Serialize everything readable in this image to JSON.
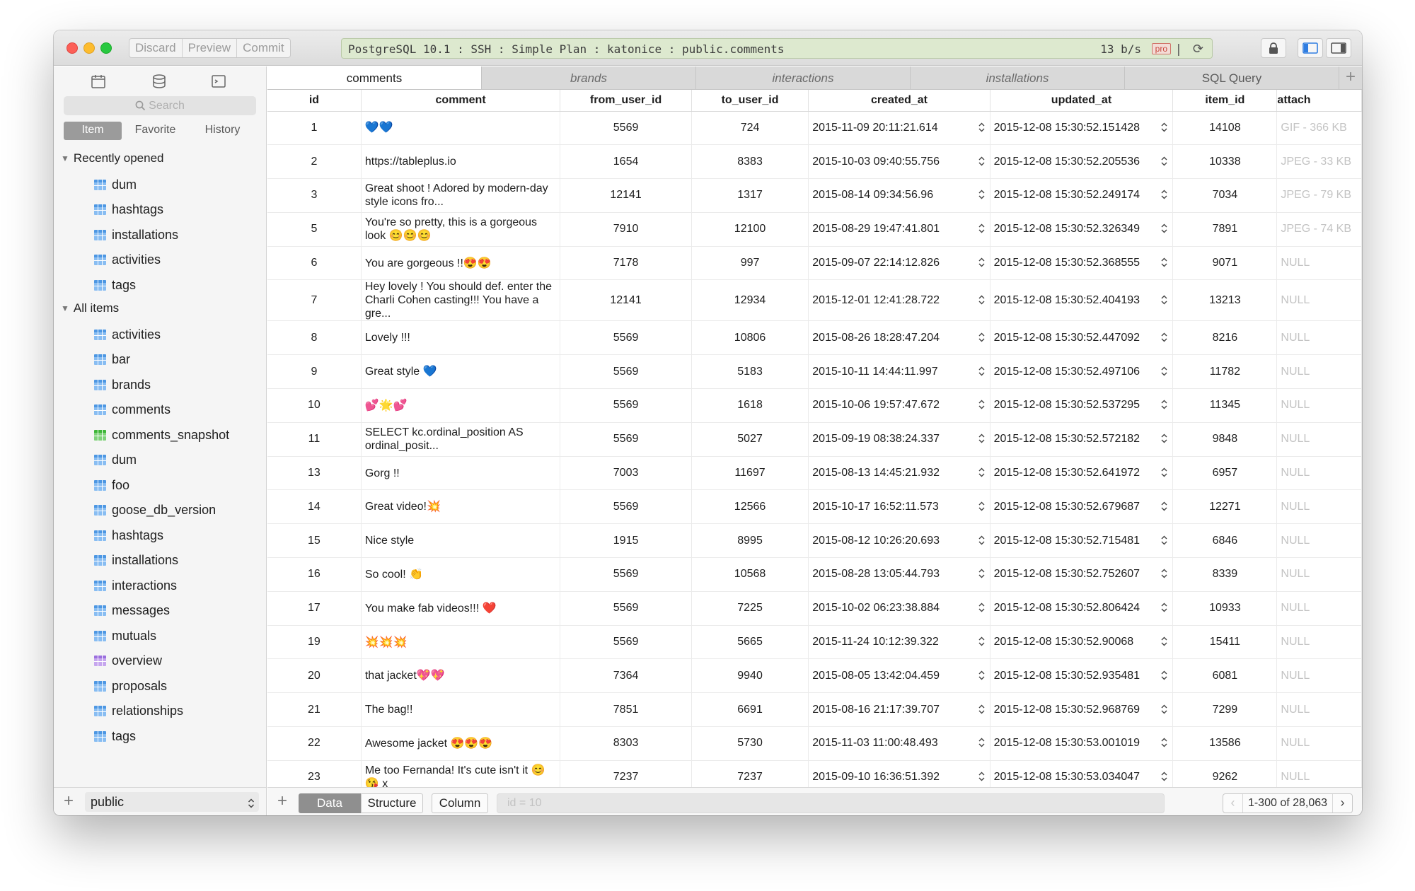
{
  "toolbar": {
    "discard": "Discard",
    "preview": "Preview",
    "commit": "Commit",
    "connection": "PostgreSQL 10.1 : SSH : Simple Plan : katonice : public.comments",
    "rate": "13 b/s",
    "pro": "pro",
    "separator": "|"
  },
  "sidebar": {
    "search_placeholder": "Search",
    "tabs": [
      "Item",
      "Favorite",
      "History"
    ],
    "recent_label": "Recently opened",
    "recent": [
      {
        "name": "dum",
        "color": "blue"
      },
      {
        "name": "hashtags",
        "color": "blue"
      },
      {
        "name": "installations",
        "color": "blue"
      },
      {
        "name": "activities",
        "color": "blue"
      },
      {
        "name": "tags",
        "color": "blue"
      }
    ],
    "all_label": "All items",
    "all": [
      {
        "name": "activities",
        "color": "blue"
      },
      {
        "name": "bar",
        "color": "blue"
      },
      {
        "name": "brands",
        "color": "blue"
      },
      {
        "name": "comments",
        "color": "blue"
      },
      {
        "name": "comments_snapshot",
        "color": "green"
      },
      {
        "name": "dum",
        "color": "blue"
      },
      {
        "name": "foo",
        "color": "blue"
      },
      {
        "name": "goose_db_version",
        "color": "blue"
      },
      {
        "name": "hashtags",
        "color": "blue"
      },
      {
        "name": "installations",
        "color": "blue"
      },
      {
        "name": "interactions",
        "color": "blue"
      },
      {
        "name": "messages",
        "color": "blue"
      },
      {
        "name": "mutuals",
        "color": "blue"
      },
      {
        "name": "overview",
        "color": "purple"
      },
      {
        "name": "proposals",
        "color": "blue"
      },
      {
        "name": "relationships",
        "color": "blue"
      },
      {
        "name": "tags",
        "color": "blue"
      }
    ],
    "schema": "public"
  },
  "tabs": [
    "comments",
    "brands",
    "interactions",
    "installations",
    "SQL Query"
  ],
  "columns": [
    "id",
    "comment",
    "from_user_id",
    "to_user_id",
    "created_at",
    "updated_at",
    "item_id",
    "attach"
  ],
  "rows": [
    {
      "id": "1",
      "comment": "💙💙",
      "from": "5569",
      "to": "724",
      "created": "2015-11-09 20:11:21.614",
      "updated": "2015-12-08 15:30:52.151428",
      "item": "14108",
      "attach": "GIF - 366 KB"
    },
    {
      "id": "2",
      "comment": "https://tableplus.io",
      "from": "1654",
      "to": "8383",
      "created": "2015-10-03 09:40:55.756",
      "updated": "2015-12-08 15:30:52.205536",
      "item": "10338",
      "attach": "JPEG - 33 KB"
    },
    {
      "id": "3",
      "comment": "Great shoot !\nAdored by modern-day style icons fro...",
      "from": "12141",
      "to": "1317",
      "created": "2015-08-14 09:34:56.96",
      "updated": "2015-12-08 15:30:52.249174",
      "item": "7034",
      "attach": "JPEG - 79 KB"
    },
    {
      "id": "5",
      "comment": "You're so pretty, this is a gorgeous look 😊😊😊",
      "from": "7910",
      "to": "12100",
      "created": "2015-08-29 19:47:41.801",
      "updated": "2015-12-08 15:30:52.326349",
      "item": "7891",
      "attach": "JPEG - 74 KB"
    },
    {
      "id": "6",
      "comment": "You are gorgeous !!😍😍",
      "from": "7178",
      "to": "997",
      "created": "2015-09-07 22:14:12.826",
      "updated": "2015-12-08 15:30:52.368555",
      "item": "9071",
      "attach": "NULL"
    },
    {
      "id": "7",
      "comment": "Hey lovely ! You should def. enter the Charli Cohen casting!!! You have a gre...",
      "from": "12141",
      "to": "12934",
      "created": "2015-12-01 12:41:28.722",
      "updated": "2015-12-08 15:30:52.404193",
      "item": "13213",
      "attach": "NULL"
    },
    {
      "id": "8",
      "comment": "Lovely !!!",
      "from": "5569",
      "to": "10806",
      "created": "2015-08-26 18:28:47.204",
      "updated": "2015-12-08 15:30:52.447092",
      "item": "8216",
      "attach": "NULL"
    },
    {
      "id": "9",
      "comment": "Great style 💙",
      "from": "5569",
      "to": "5183",
      "created": "2015-10-11 14:44:11.997",
      "updated": "2015-12-08 15:30:52.497106",
      "item": "11782",
      "attach": "NULL"
    },
    {
      "id": "10",
      "comment": "💕🌟💕",
      "from": "5569",
      "to": "1618",
      "created": "2015-10-06 19:57:47.672",
      "updated": "2015-12-08 15:30:52.537295",
      "item": "11345",
      "attach": "NULL"
    },
    {
      "id": "11",
      "comment": "SELECT\n    kc.ordinal_position AS ordinal_posit...",
      "from": "5569",
      "to": "5027",
      "created": "2015-09-19 08:38:24.337",
      "updated": "2015-12-08 15:30:52.572182",
      "item": "9848",
      "attach": "NULL"
    },
    {
      "id": "13",
      "comment": "Gorg !!",
      "from": "7003",
      "to": "11697",
      "created": "2015-08-13 14:45:21.932",
      "updated": "2015-12-08 15:30:52.641972",
      "item": "6957",
      "attach": "NULL"
    },
    {
      "id": "14",
      "comment": "Great video!💥",
      "from": "5569",
      "to": "12566",
      "created": "2015-10-17 16:52:11.573",
      "updated": "2015-12-08 15:30:52.679687",
      "item": "12271",
      "attach": "NULL"
    },
    {
      "id": "15",
      "comment": "Nice style",
      "from": "1915",
      "to": "8995",
      "created": "2015-08-12 10:26:20.693",
      "updated": "2015-12-08 15:30:52.715481",
      "item": "6846",
      "attach": "NULL"
    },
    {
      "id": "16",
      "comment": "So cool! 👏",
      "from": "5569",
      "to": "10568",
      "created": "2015-08-28 13:05:44.793",
      "updated": "2015-12-08 15:30:52.752607",
      "item": "8339",
      "attach": "NULL"
    },
    {
      "id": "17",
      "comment": "You make fab videos!!! ❤️",
      "from": "5569",
      "to": "7225",
      "created": "2015-10-02 06:23:38.884",
      "updated": "2015-12-08 15:30:52.806424",
      "item": "10933",
      "attach": "NULL"
    },
    {
      "id": "19",
      "comment": "💥💥💥",
      "from": "5569",
      "to": "5665",
      "created": "2015-11-24 10:12:39.322",
      "updated": "2015-12-08 15:30:52.90068",
      "item": "15411",
      "attach": "NULL"
    },
    {
      "id": "20",
      "comment": " that jacket💖💖",
      "from": "7364",
      "to": "9940",
      "created": "2015-08-05 13:42:04.459",
      "updated": "2015-12-08 15:30:52.935481",
      "item": "6081",
      "attach": "NULL"
    },
    {
      "id": "21",
      "comment": "The bag!!",
      "from": "7851",
      "to": "6691",
      "created": "2015-08-16 21:17:39.707",
      "updated": "2015-12-08 15:30:52.968769",
      "item": "7299",
      "attach": "NULL"
    },
    {
      "id": "22",
      "comment": "Awesome jacket 😍😍😍",
      "from": "8303",
      "to": "5730",
      "created": "2015-11-03 11:00:48.493",
      "updated": "2015-12-08 15:30:53.001019",
      "item": "13586",
      "attach": "NULL"
    },
    {
      "id": "23",
      "comment": "Me too Fernanda! It's cute isn't it 😊\n😘 x",
      "from": "7237",
      "to": "7237",
      "created": "2015-09-10 16:36:51.392",
      "updated": "2015-12-08 15:30:53.034047",
      "item": "9262",
      "attach": "NULL"
    }
  ],
  "footer": {
    "views": [
      "Data",
      "Structure",
      "Column"
    ],
    "filter_placeholder": "id = 10",
    "page_label": "1-300 of 28,063"
  },
  "colors": {
    "connection_bg": "#dde9cf",
    "null_text": "#c3c3c3",
    "accent": "#3a7fe0"
  }
}
